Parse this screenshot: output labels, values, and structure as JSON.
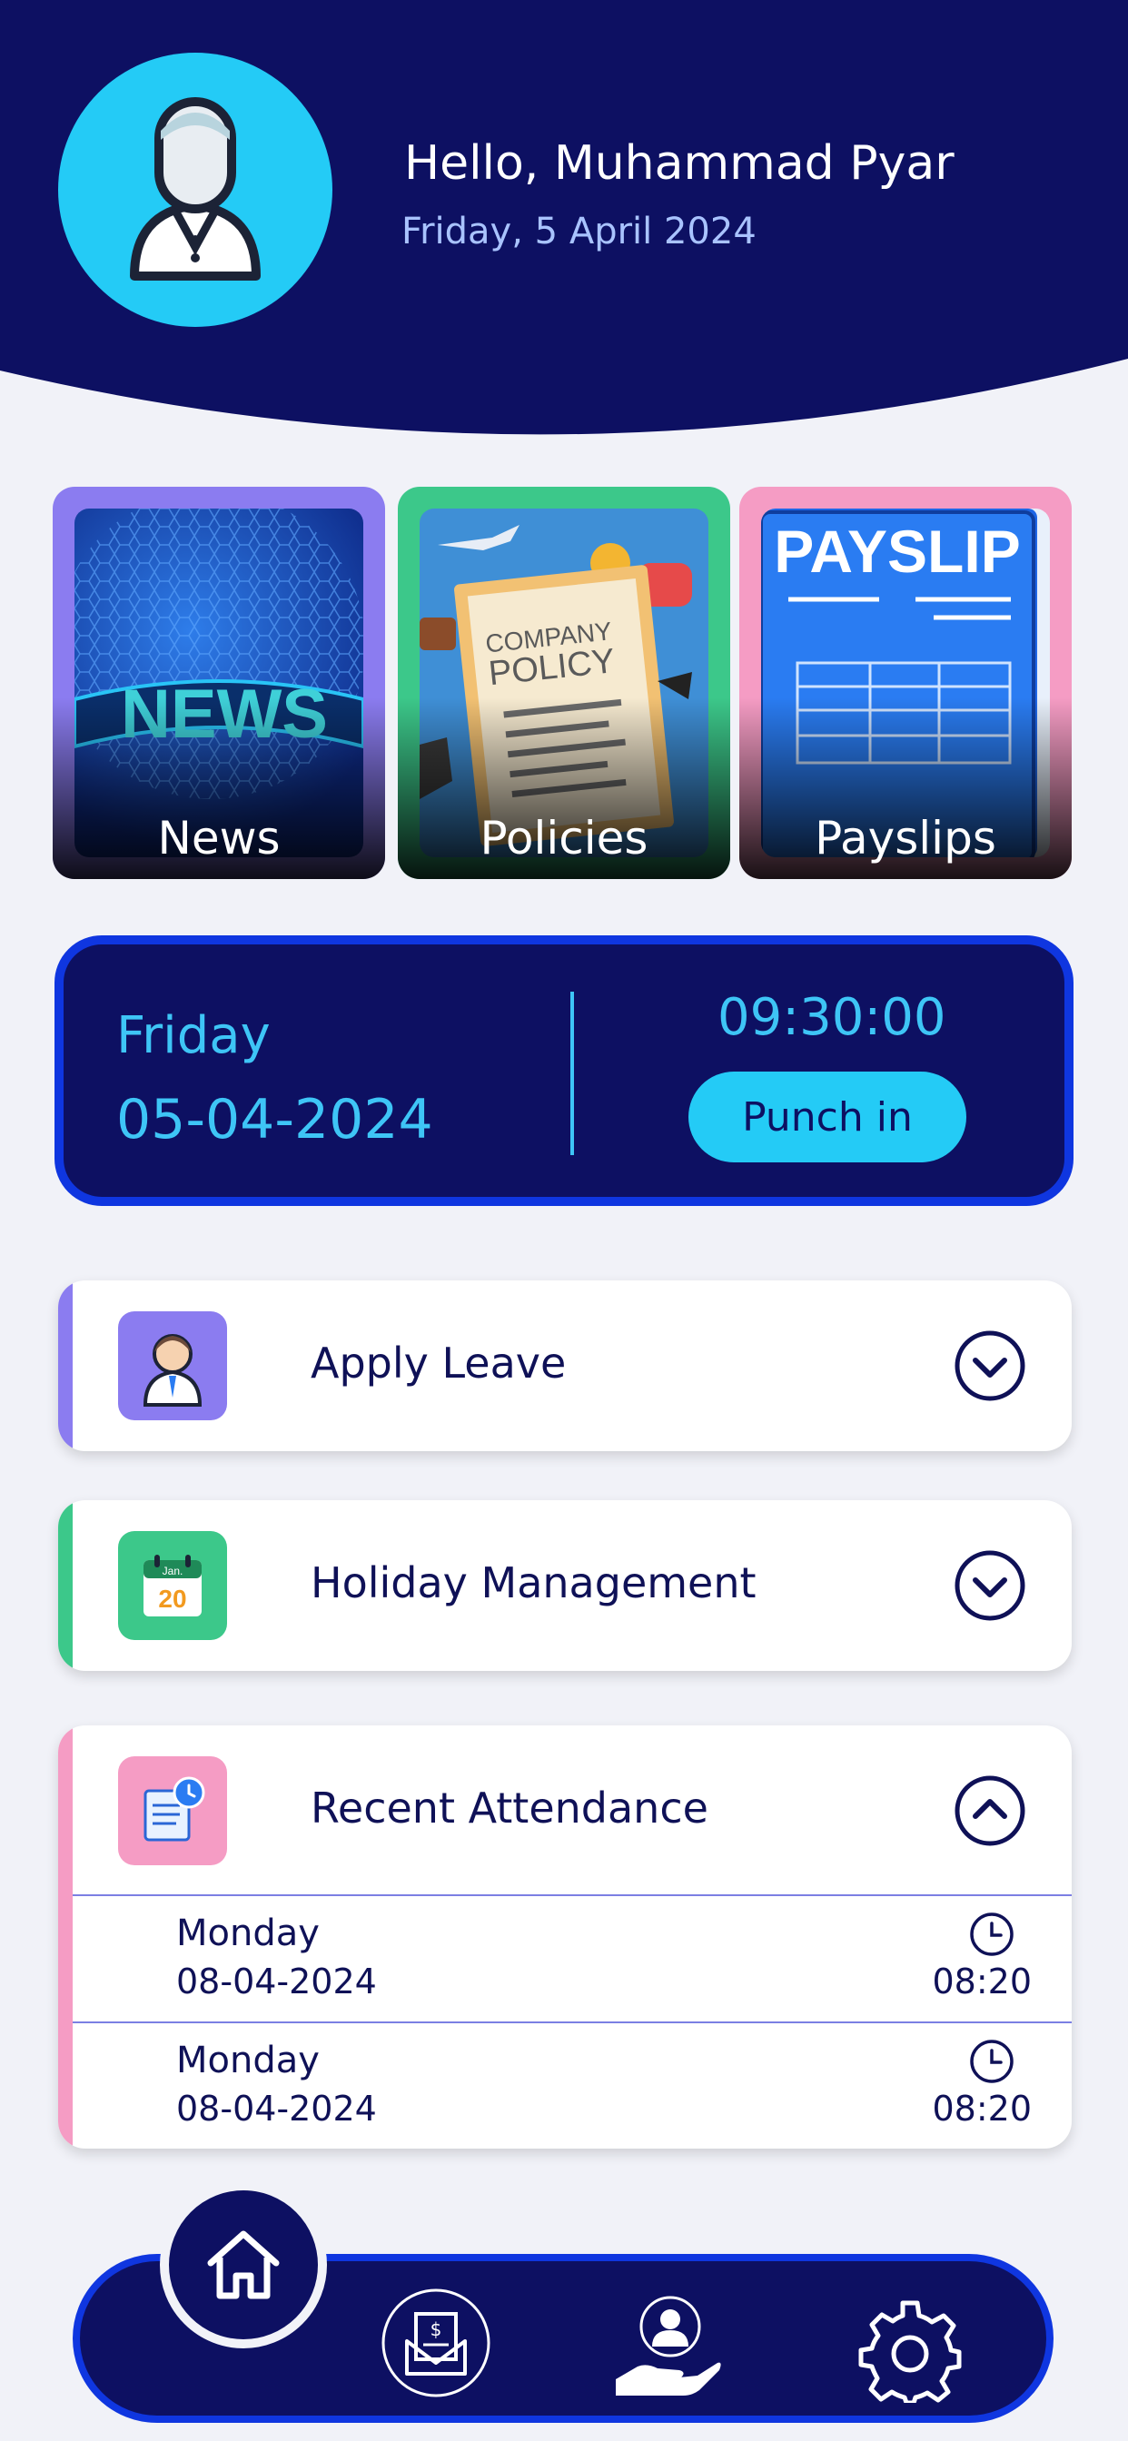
{
  "header": {
    "greeting": "Hello, Muhammad Pyar",
    "date": "Friday, 5 April 2024",
    "avatar_icon": "user-avatar-icon"
  },
  "quick_links": [
    {
      "label": "News",
      "accent": "#8b7cf0"
    },
    {
      "label": "Policies",
      "accent": "#3cc88a"
    },
    {
      "label": "Payslips",
      "accent": "#f59cc4"
    }
  ],
  "card_art": {
    "news": "NEWS",
    "policy_line1": "COMPANY",
    "policy_line2": "POLICY",
    "payslip": "PAYSLIP"
  },
  "punch": {
    "day": "Friday",
    "date": "05-04-2024",
    "time": "09:30:00",
    "button_label": "Punch in"
  },
  "sections": {
    "apply_leave": {
      "title": "Apply Leave",
      "accent": "#8b7cf0"
    },
    "holiday": {
      "title": "Holiday Management",
      "accent": "#3cc88a",
      "calendar_month": "Jan.",
      "calendar_day": "20"
    },
    "attendance": {
      "title": "Recent Attendance",
      "accent": "#f59cc4",
      "rows": [
        {
          "day": "Monday",
          "date": "08-04-2024",
          "time": "08:20"
        },
        {
          "day": "Monday",
          "date": "08-04-2024",
          "time": "08:20"
        }
      ]
    }
  },
  "nav": {
    "items": [
      "home-icon",
      "payslip-envelope-icon",
      "employee-care-icon",
      "settings-gear-icon"
    ]
  },
  "colors": {
    "navy": "#0d1062",
    "cyan": "#24cbf6",
    "blue_border": "#0f36e0",
    "background": "#f1f2f8"
  }
}
